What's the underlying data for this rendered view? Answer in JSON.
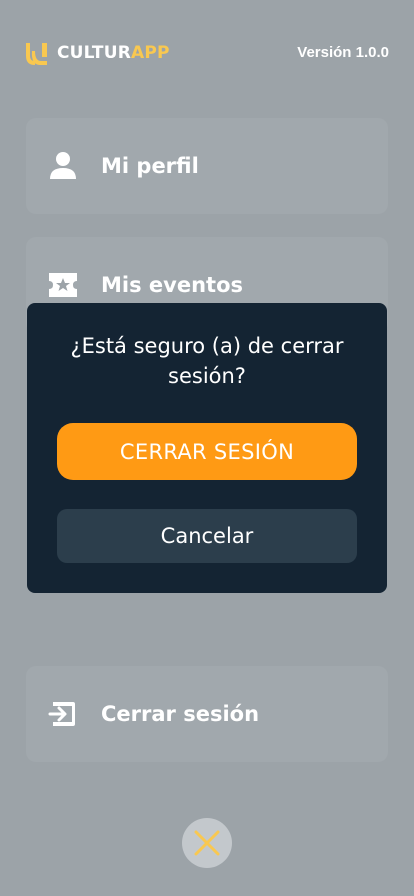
{
  "header": {
    "brand_prefix": "CULTUR",
    "brand_accent": "APP",
    "version": "Versión 1.0.0",
    "logo_color": "#f9c850"
  },
  "menu": {
    "items": [
      {
        "label": "Mi perfil",
        "icon": "user-icon"
      },
      {
        "label": "Mis eventos",
        "icon": "ticket-star-icon"
      },
      {
        "label": "Cerrar sesión",
        "icon": "logout-icon"
      }
    ]
  },
  "dialog": {
    "question": "¿Está seguro (a) de cerrar sesión?",
    "confirm_label": "CERRAR SESIÓN",
    "cancel_label": "Cancelar",
    "colors": {
      "background": "#142433",
      "confirm": "#ff9a14",
      "cancel": "#2c3e4c"
    }
  },
  "close": {
    "icon": "close-x-icon",
    "color": "#f9c850"
  }
}
